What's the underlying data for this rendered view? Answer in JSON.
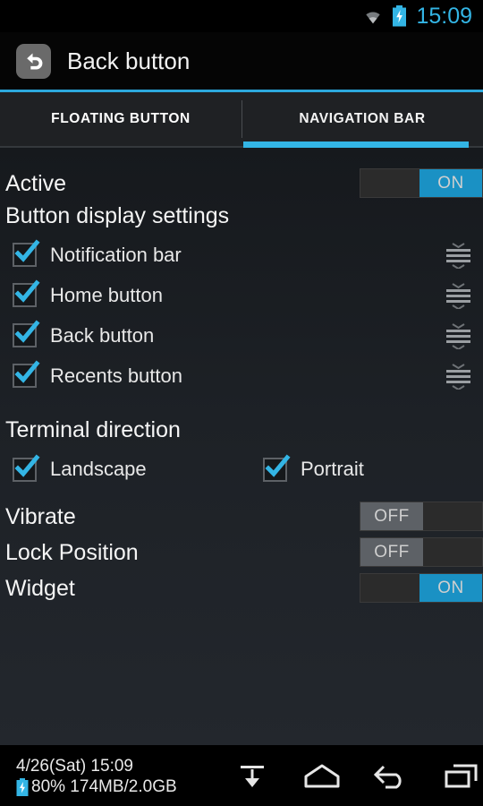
{
  "status_bar": {
    "wifi_icon": "wifi-icon",
    "battery_icon": "battery-charging-icon",
    "clock": "15:09",
    "accent_color": "#33b5e5"
  },
  "header": {
    "app_icon": "back-arrow-icon",
    "title": "Back button"
  },
  "tabs": [
    {
      "label": "FLOATING BUTTON",
      "active": false
    },
    {
      "label": "NAVIGATION BAR",
      "active": true
    }
  ],
  "main": {
    "active_row": {
      "label": "Active",
      "toggle": "ON",
      "state": "on"
    },
    "display_settings_label": "Button display settings",
    "display_items": [
      {
        "label": "Notification bar",
        "checked": true,
        "handle": "drag-handle-icon"
      },
      {
        "label": "Home button",
        "checked": true,
        "handle": "drag-handle-icon"
      },
      {
        "label": "Back button",
        "checked": true,
        "handle": "drag-handle-icon"
      },
      {
        "label": "Recents button",
        "checked": true,
        "handle": "drag-handle-icon"
      }
    ],
    "terminal_direction_label": "Terminal direction",
    "direction_options": [
      {
        "label": "Landscape",
        "checked": true
      },
      {
        "label": "Portrait",
        "checked": true
      }
    ],
    "toggle_rows": [
      {
        "label": "Vibrate",
        "toggle": "OFF",
        "state": "off"
      },
      {
        "label": "Lock Position",
        "toggle": "OFF",
        "state": "off"
      },
      {
        "label": "Widget",
        "toggle": "ON",
        "state": "on"
      }
    ]
  },
  "bottom_bar": {
    "datetime": "4/26(Sat) 15:09",
    "battery_icon": "battery-charging-icon",
    "battery_memory": "80% 174MB/2.0GB",
    "nav_keys": [
      {
        "name": "pull-down-notification-icon"
      },
      {
        "name": "home-icon"
      },
      {
        "name": "back-icon"
      },
      {
        "name": "recents-icon"
      }
    ]
  },
  "colors": {
    "accent": "#33b5e5",
    "toggle_on": "#1a91c4",
    "toggle_off": "#5d6166",
    "text": "#f5f5f5"
  }
}
